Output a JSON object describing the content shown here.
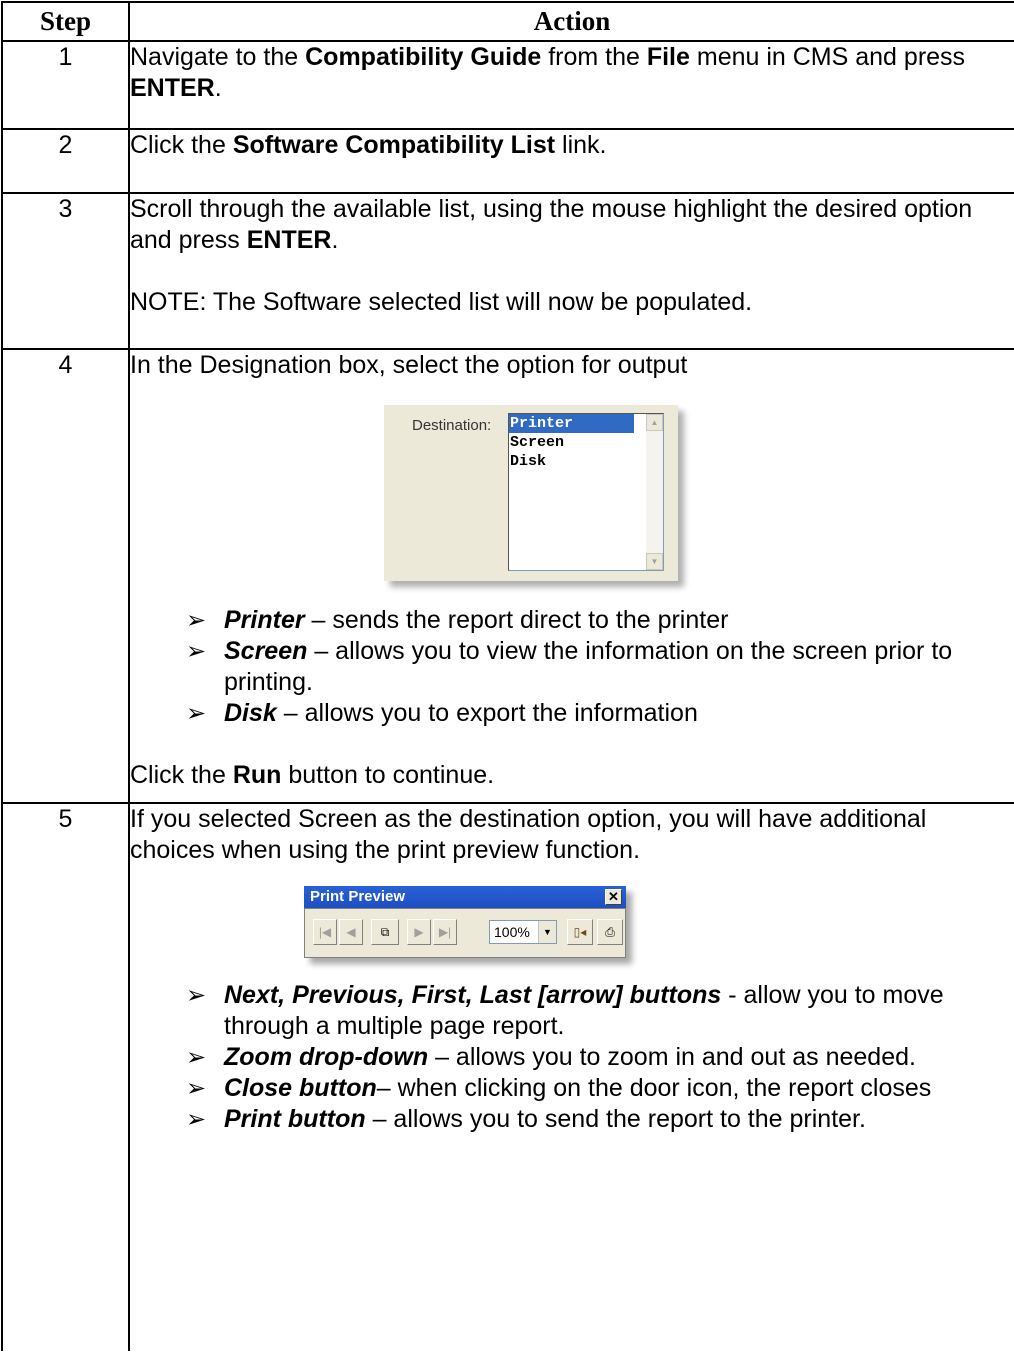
{
  "headers": {
    "step": "Step",
    "action": "Action"
  },
  "steps": [
    {
      "num": "1",
      "p1": [
        "Navigate to the ",
        "Compatibility Guide",
        " from the ",
        "File",
        " menu in CMS and press ",
        "ENTER",
        "."
      ]
    },
    {
      "num": "2",
      "p1": [
        "Click the ",
        "Software Compatibility List",
        " link."
      ]
    },
    {
      "num": "3",
      "p1": [
        "Scroll through the available list, using the mouse highlight the desired option and press ",
        "ENTER",
        "."
      ],
      "note": "NOTE: The Software selected list will now be populated."
    },
    {
      "num": "4",
      "intro": "In the Designation box, select the option for output",
      "destination": {
        "label": "Destination:",
        "options": [
          "Printer",
          "Screen",
          "Disk"
        ],
        "selected": "Printer"
      },
      "bullets": [
        {
          "term": "Printer",
          "desc": " – sends the report direct to the printer"
        },
        {
          "term": "Screen",
          "desc": " – allows you to view the information on the screen prior to printing."
        },
        {
          "term": "Disk",
          "desc": " – allows you to export the information"
        }
      ],
      "outro": [
        "Click the ",
        "Run",
        " button to continue."
      ]
    },
    {
      "num": "5",
      "intro": "If you selected Screen as the destination option, you will have additional choices when using the print preview function.",
      "preview": {
        "title": "Print Preview",
        "zoom": "100%"
      },
      "bullets": [
        {
          "term": "Next, Previous, First, Last [arrow] buttons",
          "desc": " - allow you to move through a multiple page report."
        },
        {
          "term": "Zoom drop-down",
          "desc": " – allows you to zoom in and out as needed."
        },
        {
          "term": "Close button",
          "desc": "– when clicking on the door icon, the report closes"
        },
        {
          "term": "Print button",
          "desc": " – allows you to send the report to the printer."
        }
      ]
    }
  ]
}
